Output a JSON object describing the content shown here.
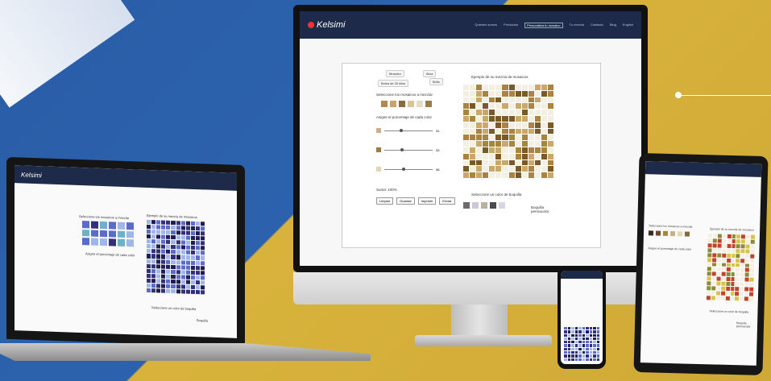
{
  "brand": {
    "logo_text": "Kelsimi"
  },
  "monitor": {
    "nav": [
      "Quienes somos",
      "Productos",
      "Personaliza tu mosaico",
      "Tu mezcla",
      "Contacto",
      "Blog",
      "English"
    ],
    "controls": {
      "dropdown_1": "Mosaico",
      "dropdown_2": "Ibiza",
      "dropdown_3": "Bolsa de 20 kilos",
      "dropdown_4": "Brillo"
    },
    "section_title_1": "Seleccione los mosaicos a mezclar",
    "section_title_2": "Asigne el porcentaje de cada color",
    "preview_title": "Ejemplo de su mezcla de mosaicos",
    "bag_title": "Seleccione un color de boquilla",
    "bag_label": "Boquilla\npermacolor",
    "summary": "Suma: 100%",
    "buttons": [
      "Limpiar",
      "Guardar",
      "Imprimir",
      "Enviar"
    ],
    "slider_values": [
      "31",
      "33",
      "36"
    ],
    "swatches": [
      "#b08a4a",
      "#c9a36a",
      "#8a6a3c",
      "#d7c49a",
      "#e6dcc2",
      "#9c7b46"
    ]
  },
  "laptop": {
    "section_title_1": "Seleccione los mosaicos a mezclar",
    "section_title_2": "Asigne el porcentaje de cada color",
    "preview_title": "Ejemplo de su mezcla de mosaicos",
    "bag_title": "Seleccione un color de boquilla",
    "bag_label": "Boquilla"
  },
  "tablet": {
    "section_title_1": "Seleccione los mosaicos a mezclar",
    "preview_title": "Ejemplo de su mezcla de mosaicos",
    "section_title_2": "Asigne el porcentaje de cada color",
    "bag_title": "Seleccione un color de boquilla",
    "bag_label": "Boquilla permacolor"
  },
  "colors": {
    "navy": "#1e2a4a",
    "gold_tile": "#a8843e",
    "cream_tile": "#f4efe3",
    "tan_tile": "#c9a86a",
    "blue_tile_dark": "#33307a",
    "blue_tile_mid": "#5a6bc9",
    "blue_tile_light": "#9fb7e8",
    "red_tile": "#c0432b",
    "yellow_tile": "#d9c24a"
  }
}
